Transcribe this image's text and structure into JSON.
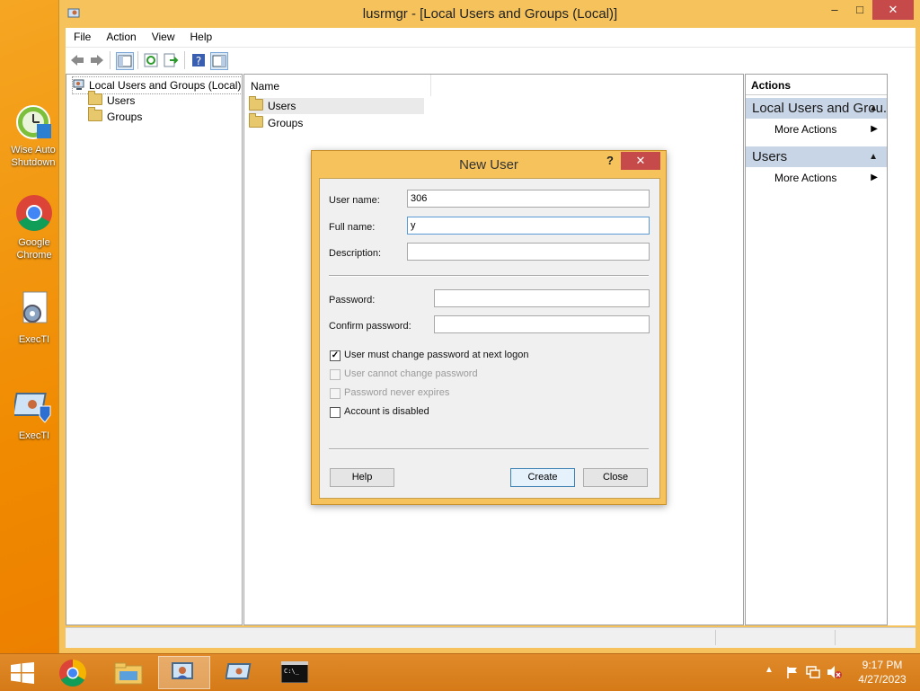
{
  "desktop": {
    "icons": [
      {
        "label": "Wise Auto Shutdown",
        "icon": "wise-auto-shutdown-icon"
      },
      {
        "label": "Google Chrome",
        "icon": "chrome-icon"
      },
      {
        "label": "ExecTI",
        "icon": "execti-gear-icon"
      },
      {
        "label": "ExecTI",
        "icon": "execti-shield-icon"
      }
    ]
  },
  "window": {
    "title": "lusrmgr - [Local Users and Groups (Local)]",
    "controls": {
      "minimize": "–",
      "maximize": "□",
      "close": "✕"
    },
    "menu": [
      "File",
      "Action",
      "View",
      "Help"
    ],
    "tree": {
      "root": "Local Users and Groups (Local)",
      "children": [
        "Users",
        "Groups"
      ]
    },
    "list": {
      "column_header": "Name",
      "rows": [
        "Users",
        "Groups"
      ],
      "selected": "Users"
    },
    "actions": {
      "header": "Actions",
      "groups": [
        {
          "title": "Local Users and Grou...",
          "item": "More Actions"
        },
        {
          "title": "Users",
          "item": "More Actions"
        }
      ]
    }
  },
  "dialog": {
    "title": "New User",
    "help_glyph": "?",
    "close_glyph": "✕",
    "fields": {
      "user_name": {
        "label": "User name:",
        "value": "306"
      },
      "full_name": {
        "label": "Full name:",
        "value": "y"
      },
      "description": {
        "label": "Description:",
        "value": ""
      },
      "password": {
        "label": "Password:",
        "value": ""
      },
      "confirm_password": {
        "label": "Confirm password:",
        "value": ""
      }
    },
    "checkboxes": [
      {
        "label": "User must change password at next logon",
        "checked": true,
        "enabled": true
      },
      {
        "label": "User cannot change password",
        "checked": false,
        "enabled": false
      },
      {
        "label": "Password never expires",
        "checked": false,
        "enabled": false
      },
      {
        "label": "Account is disabled",
        "checked": false,
        "enabled": true
      }
    ],
    "buttons": {
      "help": "Help",
      "create": "Create",
      "close": "Close"
    }
  },
  "taskbar": {
    "apps": [
      "start-icon",
      "chrome-icon",
      "file-explorer-icon",
      "lusrmgr-icon",
      "execti-icon",
      "cmd-icon"
    ],
    "clock": {
      "time": "9:17 PM",
      "date": "4/27/2023"
    }
  },
  "colors": {
    "accent": "#f5c25c",
    "desktop": "#f08a00",
    "close_red": "#c74a4a",
    "action_group": "#c8d5e6"
  }
}
